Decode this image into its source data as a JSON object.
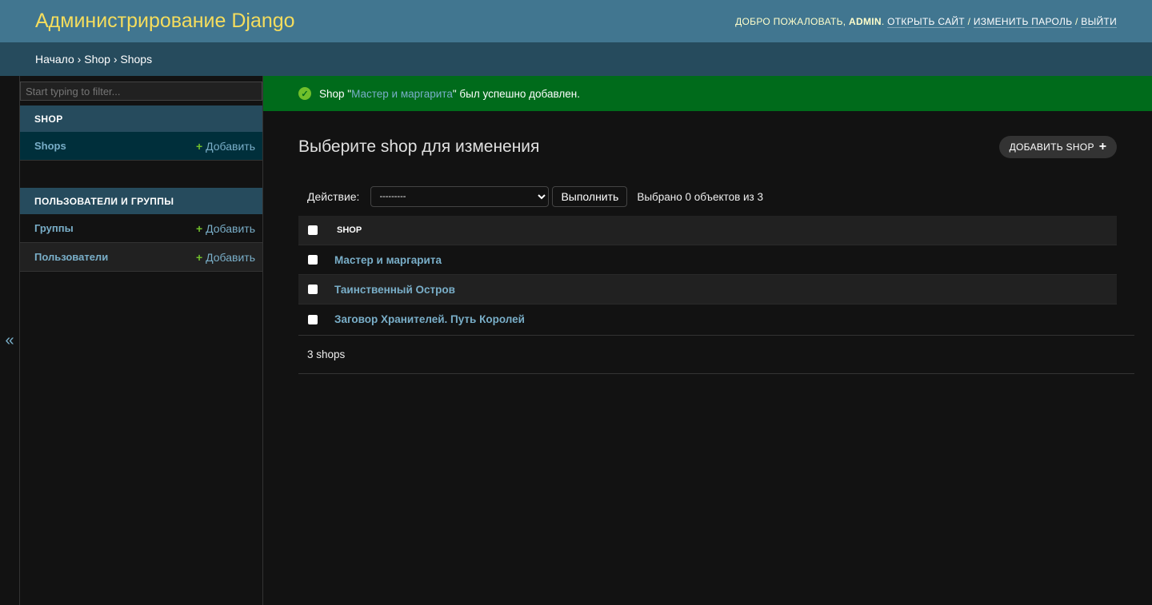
{
  "header": {
    "title": "Администрирование Django",
    "welcome": "Добро пожаловать,",
    "user": "admin",
    "view_site": "Открыть сайт",
    "change_password": "Изменить пароль",
    "logout": "Выйти"
  },
  "breadcrumbs": [
    "Начало",
    "Shop",
    "Shops"
  ],
  "sidebar": {
    "filter_placeholder": "Start typing to filter...",
    "toggle": "«",
    "apps": [
      {
        "caption": "Shop",
        "models": [
          {
            "label": "Shops",
            "add": "Добавить"
          }
        ]
      },
      {
        "caption": "Пользователи и группы",
        "models": [
          {
            "label": "Группы",
            "add": "Добавить"
          },
          {
            "label": "Пользователи",
            "add": "Добавить"
          }
        ]
      }
    ]
  },
  "message": {
    "prefix": "Shop \"",
    "link": "Мастер и маргарита",
    "suffix": "\" был успешно добавлен."
  },
  "main": {
    "title": "Выберите shop для изменения",
    "add_button": "Добавить shop",
    "action_label": "Действие:",
    "action_value": "---------",
    "go": "Выполнить",
    "selected": "Выбрано 0 объектов из 3",
    "column": "Shop",
    "rows": [
      "Мастер и маргарита",
      "Таинственный Остров",
      "Заговор Хранителей. Путь Королей"
    ],
    "count": "3 shops"
  },
  "colors": {
    "header": "#417690",
    "breadcrumbs": "#264b5d",
    "branding": "#f5dd5d",
    "success": "#006b1b",
    "link": "#79aec8",
    "add": "#70bf2b"
  }
}
